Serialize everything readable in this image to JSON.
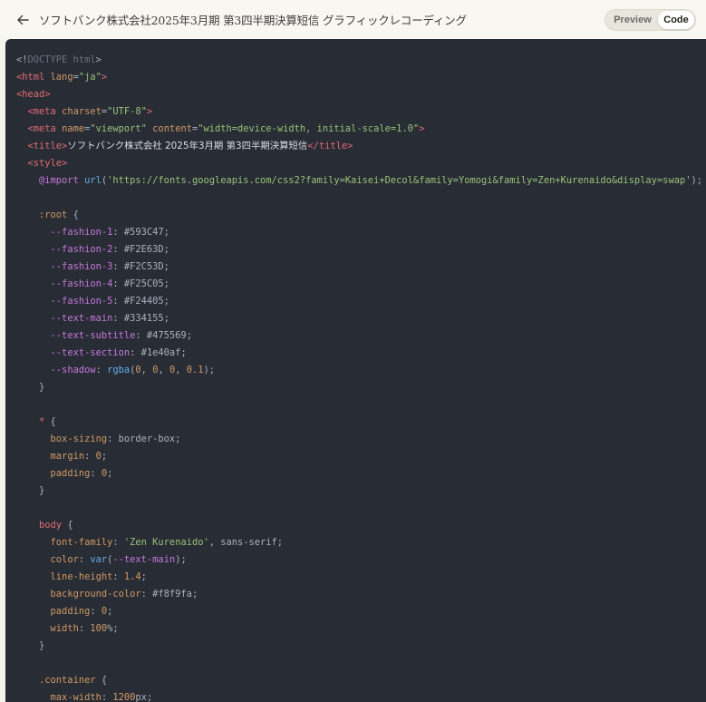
{
  "header": {
    "back_icon": "arrow-left-icon",
    "title": "ソフトバンク株式会社2025年3月期 第3四半期決算短信 グラフィックレコーディング",
    "toggle": {
      "preview_label": "Preview",
      "code_label": "Code",
      "selected": "Code"
    }
  },
  "code": {
    "lines": [
      [
        {
          "t": "<!",
          "c": "plain"
        },
        {
          "t": "DOCTYPE html",
          "c": "dim"
        },
        {
          "t": ">",
          "c": "plain"
        }
      ],
      [
        {
          "t": "<html ",
          "c": "tag"
        },
        {
          "t": "lang",
          "c": "attr"
        },
        {
          "t": "=",
          "c": "plain"
        },
        {
          "t": "\"ja\"",
          "c": "str"
        },
        {
          "t": ">",
          "c": "tag"
        }
      ],
      [
        {
          "t": "<head>",
          "c": "tag"
        }
      ],
      [
        {
          "t": "  ",
          "c": "plain"
        },
        {
          "t": "<meta ",
          "c": "tag"
        },
        {
          "t": "charset",
          "c": "attr"
        },
        {
          "t": "=",
          "c": "plain"
        },
        {
          "t": "\"UTF-8\"",
          "c": "str"
        },
        {
          "t": ">",
          "c": "tag"
        }
      ],
      [
        {
          "t": "  ",
          "c": "plain"
        },
        {
          "t": "<meta ",
          "c": "tag"
        },
        {
          "t": "name",
          "c": "attr"
        },
        {
          "t": "=",
          "c": "plain"
        },
        {
          "t": "\"viewport\"",
          "c": "str"
        },
        {
          "t": " content",
          "c": "attr"
        },
        {
          "t": "=",
          "c": "plain"
        },
        {
          "t": "\"width=device-width, initial-scale=1.0\"",
          "c": "str"
        },
        {
          "t": ">",
          "c": "tag"
        }
      ],
      [
        {
          "t": "  ",
          "c": "plain"
        },
        {
          "t": "<title>",
          "c": "tag"
        },
        {
          "t": "ソフトバンク株式会社 2025年3月期 第3四半期決算短信",
          "c": "text"
        },
        {
          "t": "</title>",
          "c": "tag"
        }
      ],
      [
        {
          "t": "  ",
          "c": "plain"
        },
        {
          "t": "<style>",
          "c": "tag"
        }
      ],
      [
        {
          "t": "    ",
          "c": "plain"
        },
        {
          "t": "@import ",
          "c": "kw"
        },
        {
          "t": "url",
          "c": "fn"
        },
        {
          "t": "(",
          "c": "plain"
        },
        {
          "t": "'https://fonts.googleapis.com/css2?family=Kaisei+Decol&family=Yomogi&family=Zen+Kurenaido&display=swap'",
          "c": "str"
        },
        {
          "t": ");",
          "c": "plain"
        }
      ],
      [
        {
          "t": "",
          "c": "plain"
        }
      ],
      [
        {
          "t": "    ",
          "c": "plain"
        },
        {
          "t": ":root",
          "c": "sel"
        },
        {
          "t": " {",
          "c": "plain"
        }
      ],
      [
        {
          "t": "      ",
          "c": "plain"
        },
        {
          "t": "--fashion-1",
          "c": "kw"
        },
        {
          "t": ": #593C47;",
          "c": "plain"
        }
      ],
      [
        {
          "t": "      ",
          "c": "plain"
        },
        {
          "t": "--fashion-2",
          "c": "kw"
        },
        {
          "t": ": #F2E63D;",
          "c": "plain"
        }
      ],
      [
        {
          "t": "      ",
          "c": "plain"
        },
        {
          "t": "--fashion-3",
          "c": "kw"
        },
        {
          "t": ": #F2C53D;",
          "c": "plain"
        }
      ],
      [
        {
          "t": "      ",
          "c": "plain"
        },
        {
          "t": "--fashion-4",
          "c": "kw"
        },
        {
          "t": ": #F25C05;",
          "c": "plain"
        }
      ],
      [
        {
          "t": "      ",
          "c": "plain"
        },
        {
          "t": "--fashion-5",
          "c": "kw"
        },
        {
          "t": ": #F24405;",
          "c": "plain"
        }
      ],
      [
        {
          "t": "      ",
          "c": "plain"
        },
        {
          "t": "--text-main",
          "c": "kw"
        },
        {
          "t": ": #334155;",
          "c": "plain"
        }
      ],
      [
        {
          "t": "      ",
          "c": "plain"
        },
        {
          "t": "--text-subtitle",
          "c": "kw"
        },
        {
          "t": ": #475569;",
          "c": "plain"
        }
      ],
      [
        {
          "t": "      ",
          "c": "plain"
        },
        {
          "t": "--text-section",
          "c": "kw"
        },
        {
          "t": ": #1e40af;",
          "c": "plain"
        }
      ],
      [
        {
          "t": "      ",
          "c": "plain"
        },
        {
          "t": "--shadow",
          "c": "kw"
        },
        {
          "t": ": ",
          "c": "plain"
        },
        {
          "t": "rgba",
          "c": "fn"
        },
        {
          "t": "(",
          "c": "plain"
        },
        {
          "t": "0",
          "c": "num"
        },
        {
          "t": ", ",
          "c": "plain"
        },
        {
          "t": "0",
          "c": "num"
        },
        {
          "t": ", ",
          "c": "plain"
        },
        {
          "t": "0",
          "c": "num"
        },
        {
          "t": ", ",
          "c": "plain"
        },
        {
          "t": "0.1",
          "c": "num"
        },
        {
          "t": ");",
          "c": "plain"
        }
      ],
      [
        {
          "t": "    }",
          "c": "plain"
        }
      ],
      [
        {
          "t": "",
          "c": "plain"
        }
      ],
      [
        {
          "t": "    ",
          "c": "plain"
        },
        {
          "t": "*",
          "c": "tag"
        },
        {
          "t": " {",
          "c": "plain"
        }
      ],
      [
        {
          "t": "      ",
          "c": "plain"
        },
        {
          "t": "box-sizing",
          "c": "attr"
        },
        {
          "t": ": border-box;",
          "c": "plain"
        }
      ],
      [
        {
          "t": "      ",
          "c": "plain"
        },
        {
          "t": "margin",
          "c": "attr"
        },
        {
          "t": ": ",
          "c": "plain"
        },
        {
          "t": "0",
          "c": "num"
        },
        {
          "t": ";",
          "c": "plain"
        }
      ],
      [
        {
          "t": "      ",
          "c": "plain"
        },
        {
          "t": "padding",
          "c": "attr"
        },
        {
          "t": ": ",
          "c": "plain"
        },
        {
          "t": "0",
          "c": "num"
        },
        {
          "t": ";",
          "c": "plain"
        }
      ],
      [
        {
          "t": "    }",
          "c": "plain"
        }
      ],
      [
        {
          "t": "",
          "c": "plain"
        }
      ],
      [
        {
          "t": "    ",
          "c": "plain"
        },
        {
          "t": "body",
          "c": "tag"
        },
        {
          "t": " {",
          "c": "plain"
        }
      ],
      [
        {
          "t": "      ",
          "c": "plain"
        },
        {
          "t": "font-family",
          "c": "attr"
        },
        {
          "t": ": ",
          "c": "plain"
        },
        {
          "t": "'Zen Kurenaido'",
          "c": "str"
        },
        {
          "t": ", sans-serif;",
          "c": "plain"
        }
      ],
      [
        {
          "t": "      ",
          "c": "plain"
        },
        {
          "t": "color",
          "c": "attr"
        },
        {
          "t": ": ",
          "c": "plain"
        },
        {
          "t": "var",
          "c": "fn"
        },
        {
          "t": "(",
          "c": "plain"
        },
        {
          "t": "--text-main",
          "c": "kw"
        },
        {
          "t": ");",
          "c": "plain"
        }
      ],
      [
        {
          "t": "      ",
          "c": "plain"
        },
        {
          "t": "line-height",
          "c": "attr"
        },
        {
          "t": ": ",
          "c": "plain"
        },
        {
          "t": "1.4",
          "c": "num"
        },
        {
          "t": ";",
          "c": "plain"
        }
      ],
      [
        {
          "t": "      ",
          "c": "plain"
        },
        {
          "t": "background-color",
          "c": "attr"
        },
        {
          "t": ": #f8f9fa;",
          "c": "plain"
        }
      ],
      [
        {
          "t": "      ",
          "c": "plain"
        },
        {
          "t": "padding",
          "c": "attr"
        },
        {
          "t": ": ",
          "c": "plain"
        },
        {
          "t": "0",
          "c": "num"
        },
        {
          "t": ";",
          "c": "plain"
        }
      ],
      [
        {
          "t": "      ",
          "c": "plain"
        },
        {
          "t": "width",
          "c": "attr"
        },
        {
          "t": ": ",
          "c": "plain"
        },
        {
          "t": "100",
          "c": "num"
        },
        {
          "t": "%;",
          "c": "plain"
        }
      ],
      [
        {
          "t": "    }",
          "c": "plain"
        }
      ],
      [
        {
          "t": "",
          "c": "plain"
        }
      ],
      [
        {
          "t": "    ",
          "c": "plain"
        },
        {
          "t": ".container",
          "c": "sel"
        },
        {
          "t": " {",
          "c": "plain"
        }
      ],
      [
        {
          "t": "      ",
          "c": "plain"
        },
        {
          "t": "max-width",
          "c": "attr"
        },
        {
          "t": ": ",
          "c": "plain"
        },
        {
          "t": "1200",
          "c": "num"
        },
        {
          "t": "px;",
          "c": "plain"
        }
      ]
    ]
  }
}
